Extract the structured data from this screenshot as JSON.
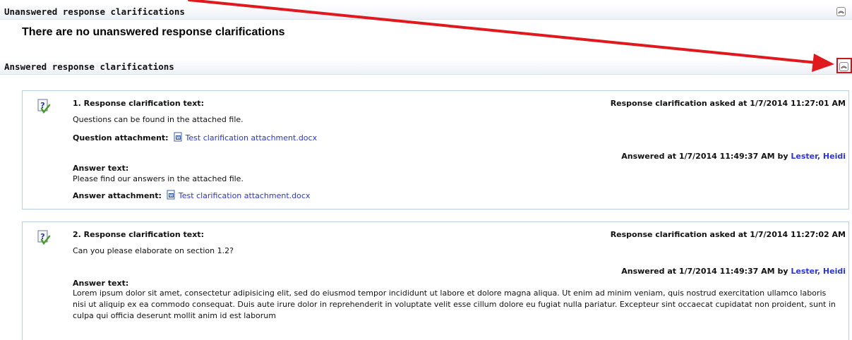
{
  "sections": {
    "unanswered": {
      "title": "Unanswered response clarifications",
      "empty_message": "There are no unanswered response clarifications"
    },
    "answered": {
      "title": "Answered response clarifications"
    }
  },
  "icons": {
    "collapse": "double-chevron-up-icon",
    "question": "question-check-icon",
    "attachment": "word-document-icon"
  },
  "colors": {
    "link": "#2a34d9",
    "card_border": "#b8cfdd",
    "annotation": "#e0191e"
  },
  "clarifications": [
    {
      "heading": "1. Response clarification text:",
      "asked_at": "Response clarification asked at 1/7/2014 11:27:01 AM",
      "question": "Questions can be found in the attached file.",
      "question_attachment_label": "Question attachment:",
      "question_attachment": "Test clarification attachment.docx",
      "answered_at": "Answered at 1/7/2014 11:49:37 AM by",
      "answered_by": "Lester, Heidi",
      "answer_label": "Answer text:",
      "answer": "Please find our answers in the attached file.",
      "answer_attachment_label": "Answer attachment:",
      "answer_attachment": "Test clarification attachment.docx"
    },
    {
      "heading": "2. Response clarification text:",
      "asked_at": "Response clarification asked at 1/7/2014 11:27:02 AM",
      "question": "Can you please elaborate on section 1.2?",
      "answered_at": "Answered at 1/7/2014 11:49:37 AM by",
      "answered_by": "Lester, Heidi",
      "answer_label": "Answer text:",
      "answer": "Lorem ipsum dolor sit amet, consectetur adipisicing elit, sed do eiusmod tempor incididunt ut labore et dolore magna aliqua. Ut enim ad minim veniam, quis nostrud exercitation ullamco laboris nisi ut aliquip ex ea commodo consequat. Duis aute irure dolor in reprehenderit in voluptate velit esse cillum dolore eu fugiat nulla pariatur. Excepteur sint occaecat cupidatat non proident, sunt in culpa qui officia deserunt mollit anim id est laborum"
    }
  ]
}
